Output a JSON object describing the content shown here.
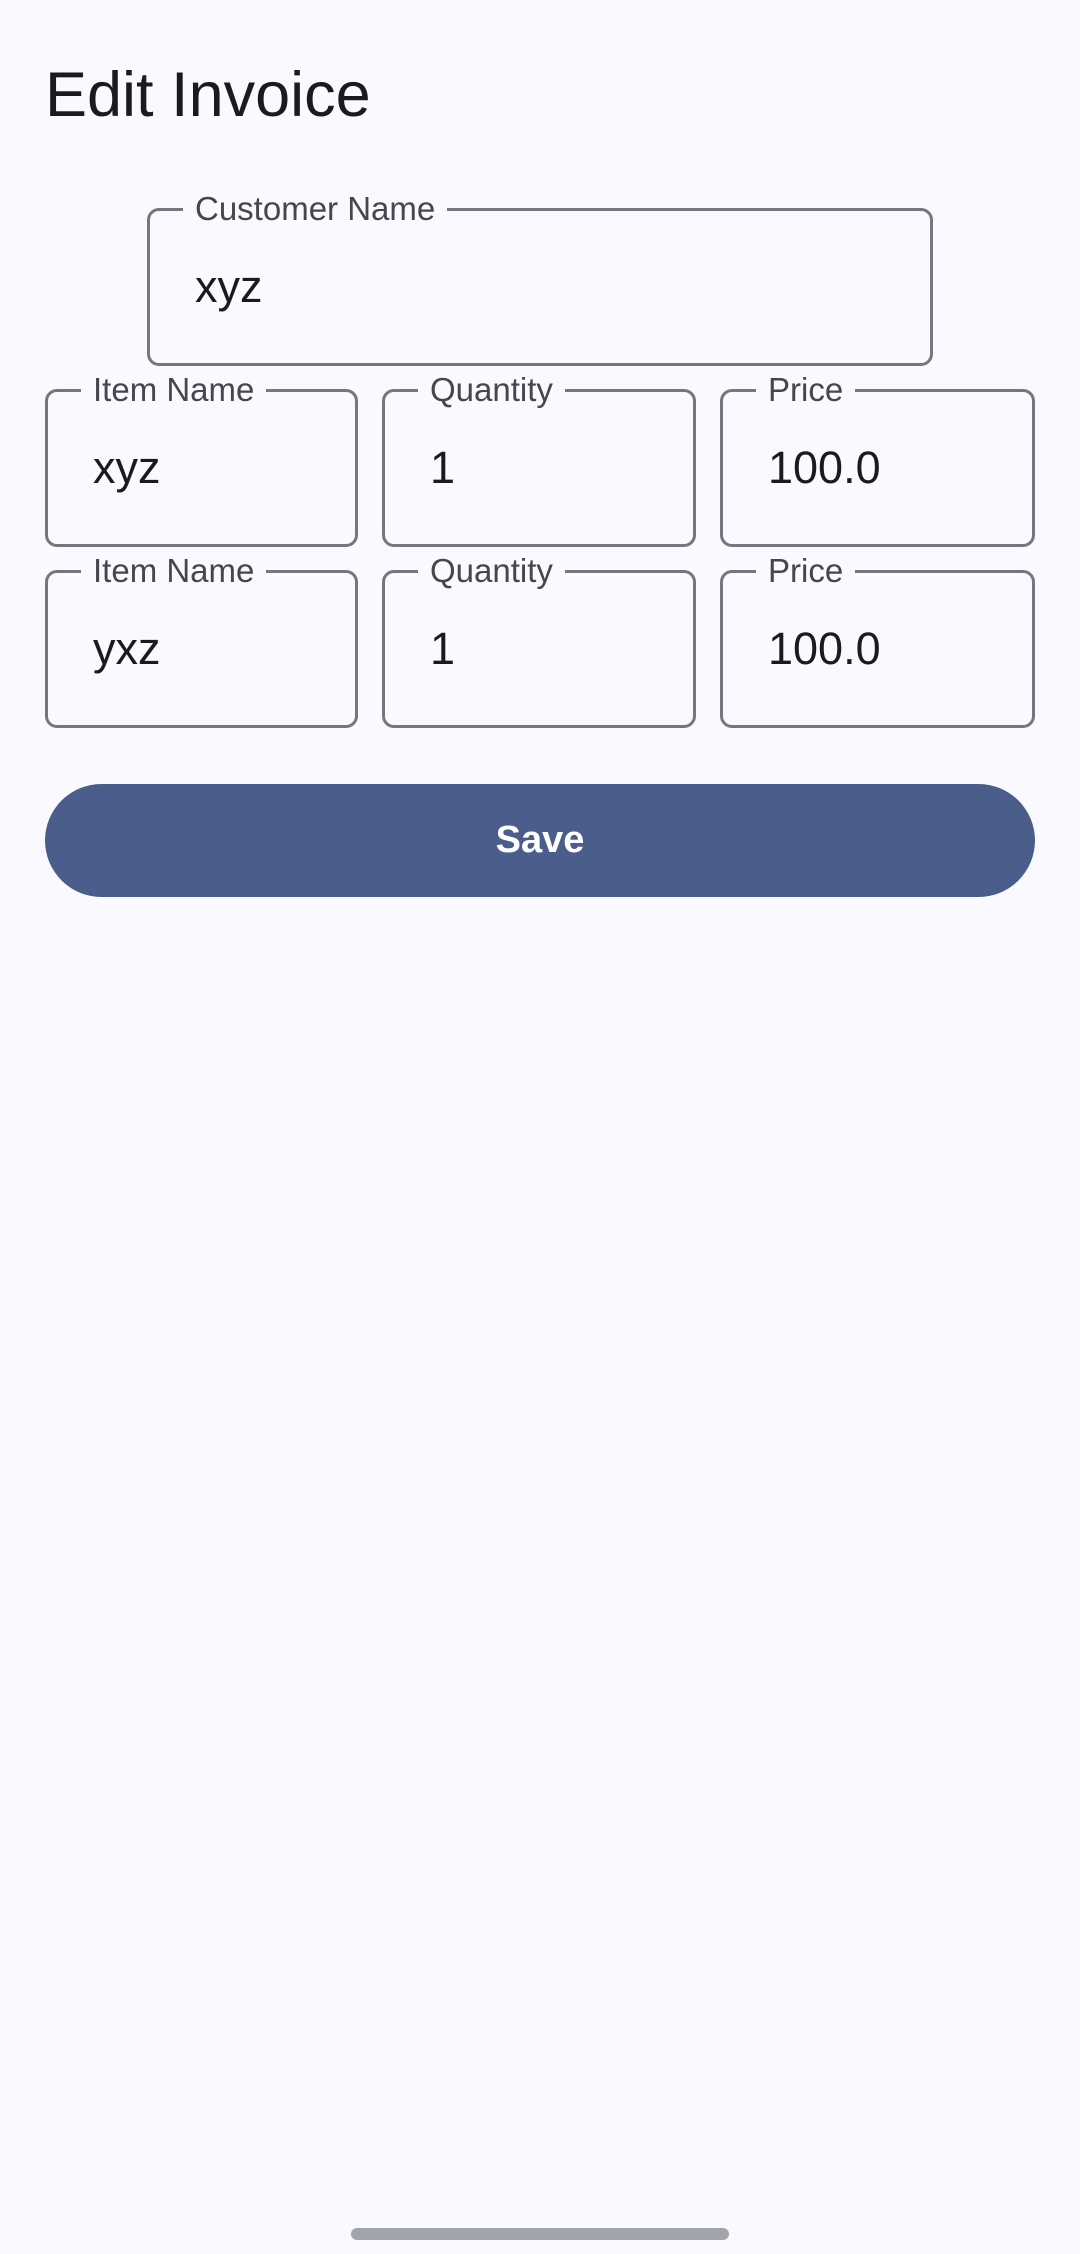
{
  "page": {
    "title": "Edit Invoice"
  },
  "customer": {
    "label": "Customer Name",
    "value": "xyz"
  },
  "items": [
    {
      "name_label": "Item Name",
      "name_value": "xyz",
      "quantity_label": "Quantity",
      "quantity_value": "1",
      "price_label": "Price",
      "price_value": "100.0"
    },
    {
      "name_label": "Item Name",
      "name_value": "yxz",
      "quantity_label": "Quantity",
      "quantity_value": "1",
      "price_label": "Price",
      "price_value": "100.0"
    }
  ],
  "actions": {
    "save_label": "Save"
  },
  "colors": {
    "background": "#f9f9ff",
    "primary": "#4a5d8b",
    "outline": "#74777f",
    "label": "#44474e",
    "text": "#1a1b20"
  }
}
